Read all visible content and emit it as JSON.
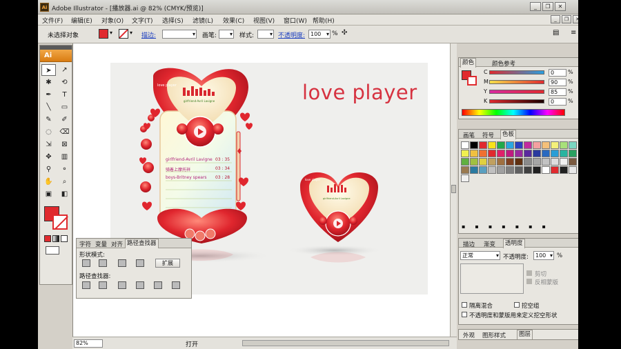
{
  "titlebar": {
    "badge": "Ai",
    "title": "Adobe Illustrator - [播放器.ai @ 82% (CMYK/预览)]",
    "min": "_",
    "restore": "❐",
    "close": "✕"
  },
  "menu": [
    "文件(F)",
    "编辑(E)",
    "对象(O)",
    "文字(T)",
    "选择(S)",
    "滤镜(L)",
    "效果(C)",
    "视图(V)",
    "窗口(W)",
    "帮助(H)"
  ],
  "control": {
    "no_selection": "未选择对象",
    "stroke_link": "描边:",
    "brush": "画笔:",
    "style": "样式:",
    "opacity_link": "不透明度:",
    "opacity_value": "100",
    "opacity_unit": "%",
    "fill_color": "#e02a2e"
  },
  "tools": {
    "logo": "Ai",
    "items": [
      "➤",
      "↗",
      "✱",
      "⟲",
      "✒",
      "T",
      "╲",
      "▭",
      "✎",
      "✐",
      "◌",
      "⌫",
      "⇲",
      "⊠",
      "✥",
      "▥",
      "⚲",
      "⚬",
      "✋",
      "⌕",
      "▣",
      "◧"
    ]
  },
  "art": {
    "title": "love player",
    "songs": [
      {
        "name": "girlfriend-Avril Lavigne",
        "time": "03 : 35"
      },
      {
        "name": "骑着上摩托祥",
        "time": "03 : 34"
      },
      {
        "name": "boys-Britney spears",
        "time": "03 : 28"
      }
    ],
    "now_playing": "girlfriend-Avril Lavigne",
    "logo_small": "love player"
  },
  "pathfinder": {
    "tabs": [
      "字符",
      "变量",
      "对齐",
      "路径查找器"
    ],
    "shape_modes": "形状模式:",
    "expand": "扩展",
    "pathfinders": "路径查找器:"
  },
  "statusbar": {
    "zoom": "82%",
    "status": "打开"
  },
  "color_panel": {
    "tabs": [
      "颜色",
      "颜色参考"
    ],
    "channels": [
      {
        "label": "C",
        "value": "0",
        "unit": "%"
      },
      {
        "label": "M",
        "value": "90",
        "unit": "%"
      },
      {
        "label": "Y",
        "value": "85",
        "unit": "%"
      },
      {
        "label": "K",
        "value": "0",
        "unit": "%"
      }
    ]
  },
  "swatch_panel": {
    "tabs": [
      "画笔",
      "符号",
      "色板"
    ]
  },
  "transparency_panel": {
    "tabs": [
      "描边",
      "渐变",
      "透明度"
    ],
    "blend_mode": "正常",
    "opacity_label": "不透明度:",
    "opacity_value": "100",
    "opacity_unit": "%",
    "clip": "剪切",
    "invert_mask": "反相蒙版",
    "isolate_blend": "隔离混合",
    "knockout": "挖空组",
    "opacity_mask_def": "不透明度和蒙版用来定义挖空形状"
  },
  "bottom_tabs": [
    "外观",
    "图形样式",
    "图层"
  ]
}
